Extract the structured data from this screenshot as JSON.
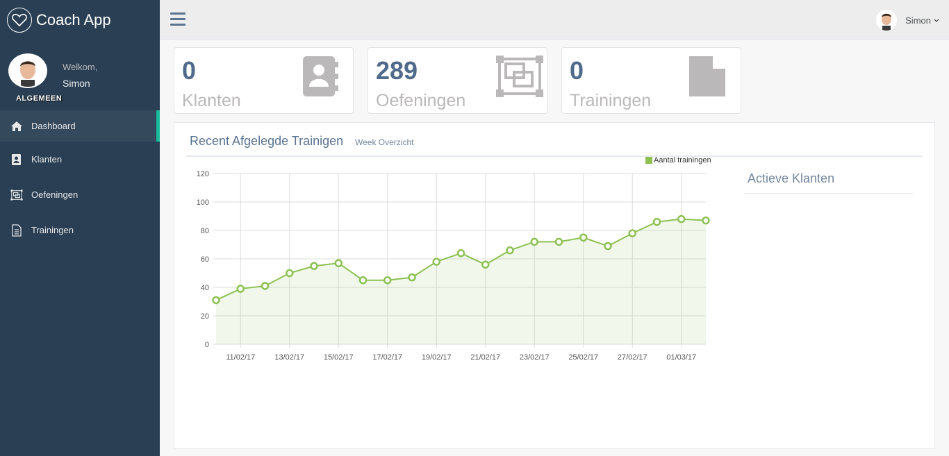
{
  "app": {
    "brand": "Coach App"
  },
  "sidebar": {
    "welcome": "Welkom,",
    "username": "Simon",
    "section": "ALGEMEEN",
    "items": [
      {
        "label": "Dashboard",
        "icon": "home-icon",
        "active": true
      },
      {
        "label": "Klanten",
        "icon": "address-book-icon"
      },
      {
        "label": "Oefeningen",
        "icon": "object-group-icon"
      },
      {
        "label": "Trainingen",
        "icon": "file-text-icon"
      }
    ]
  },
  "topbar": {
    "user": "Simon",
    "menu_icon": "hamburger-icon"
  },
  "tiles": [
    {
      "count": "0",
      "label": "Klanten",
      "icon": "address-book-icon"
    },
    {
      "count": "289",
      "label": "Oefeningen",
      "icon": "object-group-icon"
    },
    {
      "count": "0",
      "label": "Trainingen",
      "icon": "file-icon"
    }
  ],
  "panel": {
    "title": "Recent Afgelegde Trainigen",
    "subtitle": "Week Overzicht",
    "side_title": "Actieve Klanten"
  },
  "colors": {
    "sidebar": "#2a3f54",
    "accent": "#1abb9c",
    "series": "#8cc152",
    "count": "#4f6a8a"
  },
  "chart_data": {
    "type": "area",
    "x": [
      "10/02/17",
      "11/02/17",
      "12/02/17",
      "13/02/17",
      "14/02/17",
      "15/02/17",
      "16/02/17",
      "17/02/17",
      "18/02/17",
      "19/02/17",
      "20/02/17",
      "21/02/17",
      "22/02/17",
      "23/02/17",
      "24/02/17",
      "25/02/17",
      "26/02/17",
      "27/02/17",
      "28/02/17",
      "01/03/17",
      "02/03/17"
    ],
    "x_tick_labels": [
      "11/02/17",
      "13/02/17",
      "15/02/17",
      "17/02/17",
      "19/02/17",
      "21/02/17",
      "23/02/17",
      "25/02/17",
      "27/02/17",
      "01/03/17"
    ],
    "series": [
      {
        "name": "Aantal trainingen",
        "values": [
          31,
          39,
          41,
          50,
          55,
          57,
          45,
          45,
          47,
          58,
          64,
          56,
          66,
          72,
          72,
          75,
          69,
          78,
          86,
          88,
          87
        ]
      }
    ],
    "ylim": [
      0,
      120
    ],
    "y_ticks": [
      0,
      20,
      40,
      60,
      80,
      100,
      120
    ],
    "grid": true,
    "legend": "top-right"
  }
}
